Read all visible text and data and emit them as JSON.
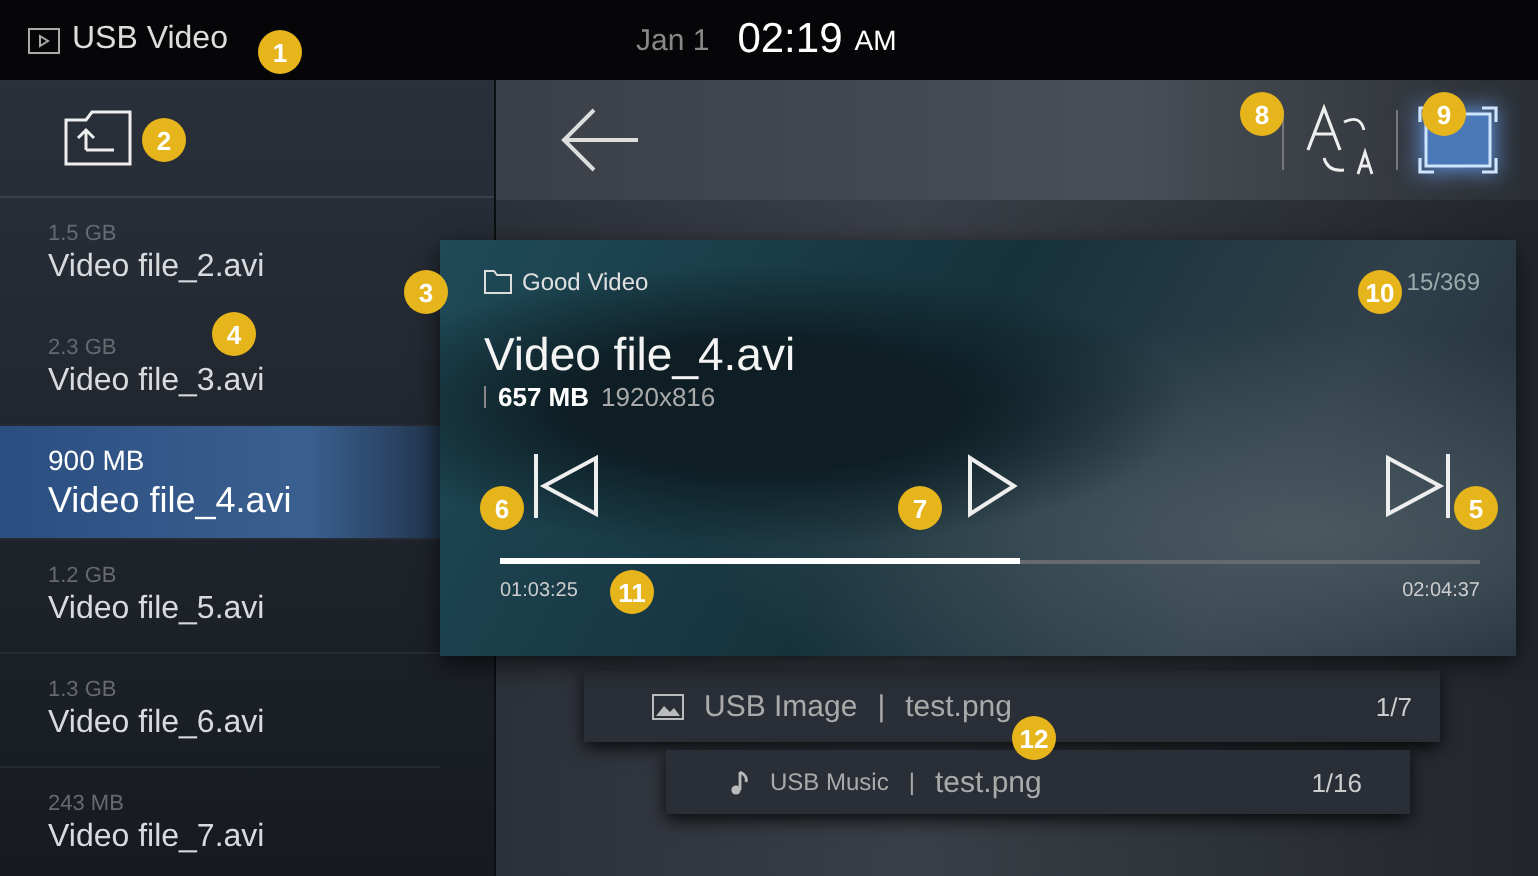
{
  "status_bar": {
    "source_label": "USB Video",
    "date": "Jan 1",
    "time": "02:19",
    "meridiem": "AM"
  },
  "sidebar": {
    "files": [
      {
        "size": "1.5 GB",
        "name": "Video file_2.avi",
        "selected": false
      },
      {
        "size": "2.3 GB",
        "name": "Video file_3.avi",
        "selected": false
      },
      {
        "size": "900 MB",
        "name": "Video file_4.avi",
        "selected": true
      },
      {
        "size": "1.2 GB",
        "name": "Video file_5.avi",
        "selected": false
      },
      {
        "size": "1.3 GB",
        "name": "Video file_6.avi",
        "selected": false
      },
      {
        "size": "243 MB",
        "name": "Video file_7.avi",
        "selected": false
      }
    ]
  },
  "player": {
    "folder": "Good Video",
    "position": "15/369",
    "title": "Video file_4.avi",
    "file_size": "657 MB",
    "resolution": "1920x816",
    "playback": {
      "level": 0.53,
      "elapsed": "01:03:25",
      "total": "02:04:37"
    }
  },
  "other_media": [
    {
      "kind": "image",
      "source": "USB Image",
      "separator": "|",
      "file": "test.png",
      "position": "1/7"
    },
    {
      "kind": "music",
      "source": "USB Music",
      "separator": "|",
      "file": "test.png",
      "position": "1/16"
    }
  ],
  "callouts": [
    "1",
    "8",
    "9",
    "2",
    "3",
    "10",
    "4",
    "6",
    "7",
    "5",
    "11",
    "12"
  ]
}
